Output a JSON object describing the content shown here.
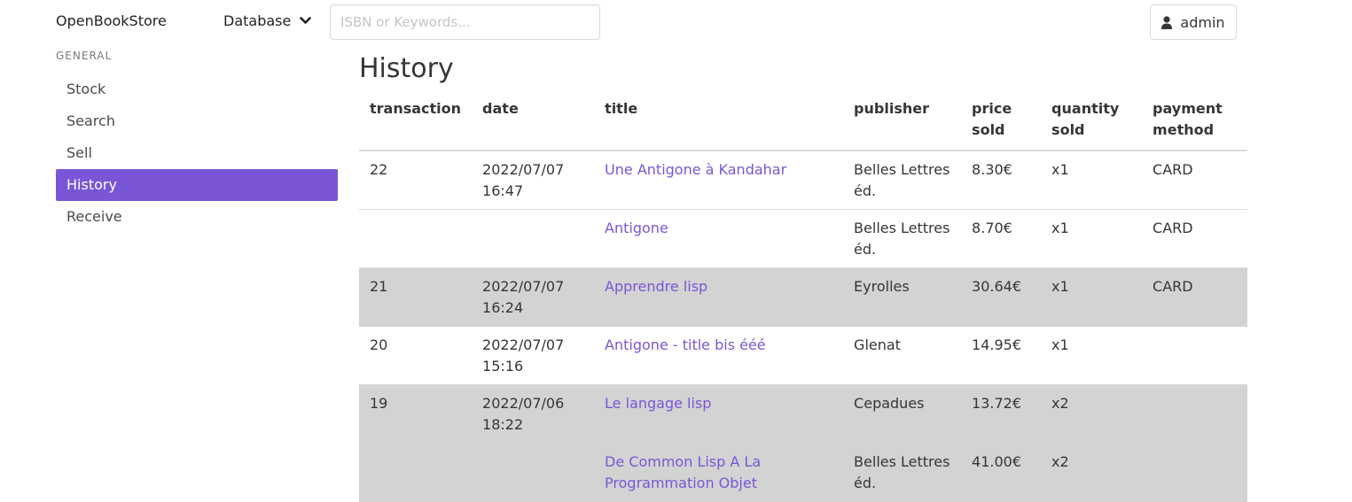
{
  "navbar": {
    "brand": "OpenBookStore",
    "database_label": "Database",
    "search_placeholder": "ISBN or Keywords...",
    "user_label": "admin",
    "icons": [
      "chevron-down-icon",
      "user-icon"
    ]
  },
  "sidebar": {
    "section_label": "GENERAL",
    "items": [
      {
        "label": "Stock"
      },
      {
        "label": "Search"
      },
      {
        "label": "Sell"
      },
      {
        "label": "History",
        "active": true
      },
      {
        "label": "Receive"
      }
    ],
    "active_color": "#7a56d6"
  },
  "main": {
    "title": "History",
    "table": {
      "headers": {
        "transaction": "transaction",
        "date": "date",
        "title": "title",
        "publisher": "publisher",
        "price_sold_1": "price",
        "price_sold_2": "sold",
        "quantity_sold_1": "quantity",
        "quantity_sold_2": "sold",
        "payment_method_1": "payment",
        "payment_method_2": "method"
      },
      "rows": [
        {
          "transaction": "22",
          "date": "2022/07/07",
          "time": "16:47",
          "title": "Une Antigone à Kandahar",
          "publisher": "Belles Lettres éd.",
          "price": "8.30€",
          "quantity": "x1",
          "payment": "CARD"
        },
        {
          "transaction": "",
          "date": "",
          "time": "",
          "title": "Antigone",
          "publisher": "Belles Lettres éd.",
          "price": "8.70€",
          "quantity": "x1",
          "payment": "CARD"
        },
        {
          "transaction": "21",
          "date": "2022/07/07",
          "time": "16:24",
          "title": "Apprendre lisp",
          "publisher": "Eyrolles",
          "price": "30.64€",
          "quantity": "x1",
          "payment": "CARD"
        },
        {
          "transaction": "20",
          "date": "2022/07/07",
          "time": "15:16",
          "title": "Antigone - title bis ééé",
          "publisher": "Glenat",
          "price": "14.95€",
          "quantity": "x1",
          "payment": ""
        },
        {
          "transaction": "19",
          "date": "2022/07/06",
          "time": "18:22",
          "title": "Le langage lisp",
          "publisher": "Cepadues",
          "price": "13.72€",
          "quantity": "x2",
          "payment": ""
        },
        {
          "transaction": "",
          "date": "",
          "time": "",
          "title": "De Common Lisp A La Programmation Objet",
          "publisher": "Belles Lettres éd.",
          "price": "41.00€",
          "quantity": "x2",
          "payment": ""
        }
      ],
      "row_highlight_color": "#d3d3d3",
      "link_color": "#7a56d6"
    }
  }
}
